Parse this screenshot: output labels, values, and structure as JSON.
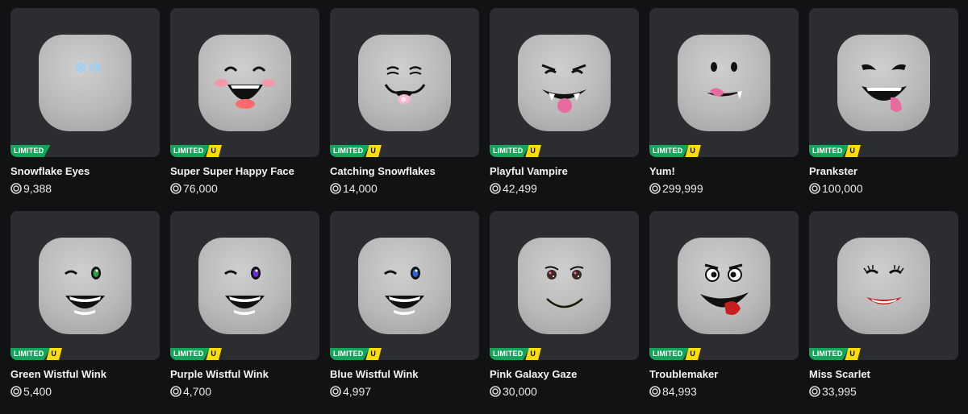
{
  "badges": {
    "limited": "LIMITED",
    "unique": "U"
  },
  "items": [
    {
      "name": "Snowflake Eyes",
      "price": "9,388",
      "unique": false,
      "face": "snowflake-eyes"
    },
    {
      "name": "Super Super Happy Face",
      "price": "76,000",
      "unique": true,
      "face": "super-happy"
    },
    {
      "name": "Catching Snowflakes",
      "price": "14,000",
      "unique": true,
      "face": "catching-snowflakes"
    },
    {
      "name": "Playful Vampire",
      "price": "42,499",
      "unique": true,
      "face": "playful-vampire"
    },
    {
      "name": "Yum!",
      "price": "299,999",
      "unique": true,
      "face": "yum"
    },
    {
      "name": "Prankster",
      "price": "100,000",
      "unique": true,
      "face": "prankster"
    },
    {
      "name": "Green Wistful Wink",
      "price": "5,400",
      "unique": true,
      "face": "green-wink"
    },
    {
      "name": "Purple Wistful Wink",
      "price": "4,700",
      "unique": true,
      "face": "purple-wink"
    },
    {
      "name": "Blue Wistful Wink",
      "price": "4,997",
      "unique": true,
      "face": "blue-wink"
    },
    {
      "name": "Pink Galaxy Gaze",
      "price": "30,000",
      "unique": true,
      "face": "pink-galaxy"
    },
    {
      "name": "Troublemaker",
      "price": "84,993",
      "unique": true,
      "face": "troublemaker"
    },
    {
      "name": "Miss Scarlet",
      "price": "33,995",
      "unique": true,
      "face": "miss-scarlet"
    }
  ],
  "colors": {
    "background": "#111214",
    "card": "#2b2d31",
    "limited_badge": "#12a65a",
    "unique_badge": "#ffdd00",
    "green_eye": "#2f9e44",
    "purple_eye": "#6a2bd6",
    "blue_eye": "#2b63d6",
    "tongue": "#e86aa0",
    "lips": "#c81e1e",
    "snowflake": "#8fd3ff"
  }
}
